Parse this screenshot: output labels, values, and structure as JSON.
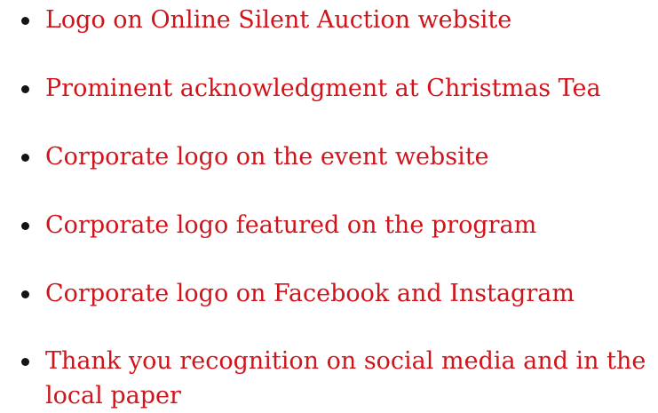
{
  "benefits": {
    "items": [
      "Logo on Online Silent Auction website",
      "Prominent acknowledgment at Christmas Tea",
      "Corporate logo on the event website",
      "Corporate logo featured on the program",
      "Corporate logo on Facebook and Instagram",
      "Thank you recognition on social media and in the local paper"
    ]
  },
  "colors": {
    "text": "#d0141b",
    "bullet": "#141414",
    "background": "#ffffff"
  }
}
